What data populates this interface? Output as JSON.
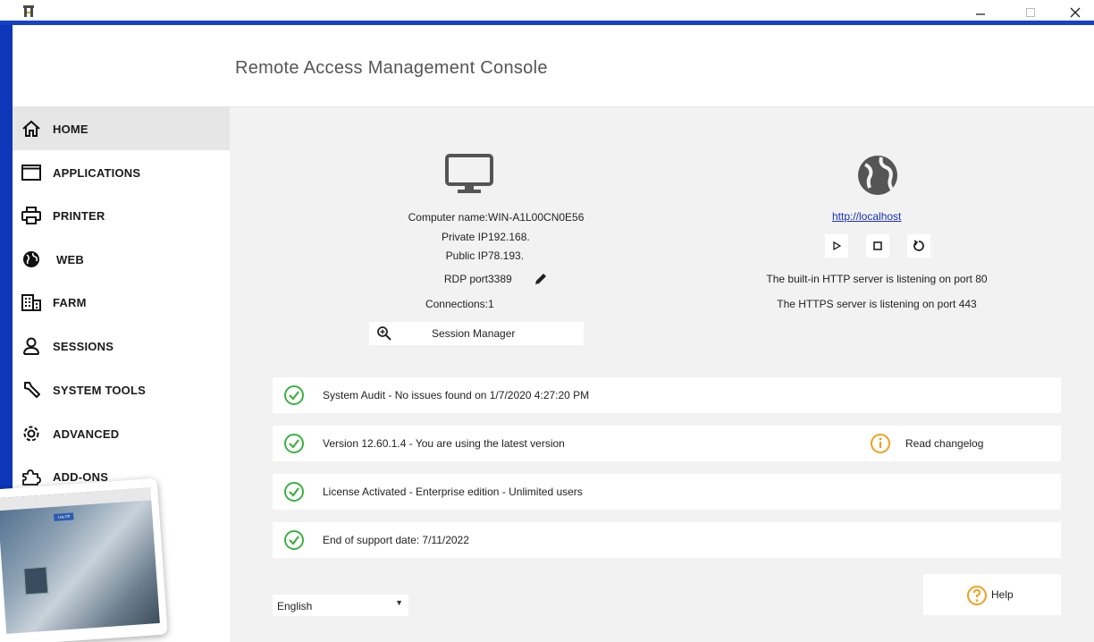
{
  "header": {
    "title": "Remote Access Management Console"
  },
  "sidebar": {
    "items": [
      {
        "label": "HOME",
        "icon": "home-icon",
        "active": true
      },
      {
        "label": "APPLICATIONS",
        "icon": "window-icon"
      },
      {
        "label": "PRINTER",
        "icon": "printer-icon"
      },
      {
        "label": "WEB",
        "icon": "globe-icon"
      },
      {
        "label": "FARM",
        "icon": "building-icon"
      },
      {
        "label": "SESSIONS",
        "icon": "user-icon"
      },
      {
        "label": "SYSTEM TOOLS",
        "icon": "wrench-icon"
      },
      {
        "label": "ADVANCED",
        "icon": "gear-icon"
      },
      {
        "label": "ADD-ONS",
        "icon": "puzzle-icon"
      }
    ]
  },
  "computer": {
    "name_label": "Computer name:",
    "name_value": "WIN-A1L00CN0E56",
    "private_label": "Private IP",
    "private_value": "192.168.",
    "public_label": "Public IP",
    "public_value": "78.193.",
    "rdp_label": "RDP port",
    "rdp_value": "3389",
    "connections_label": "Connections:",
    "connections_value": "1",
    "session_manager_label": "Session Manager"
  },
  "web": {
    "link": "http://localhost",
    "http_status": "The built-in HTTP server is listening on port 80",
    "https_status": "The HTTPS server is listening on port 443"
  },
  "status": {
    "audit": "System Audit - No issues found on 1/7/2020 4:27:20 PM",
    "version": "Version 12.60.1.4 - You are using the latest version",
    "changelog": "Read changelog",
    "license": "License Activated - Enterprise edition - Unlimited users",
    "support": "End of support date: 7/11/2022"
  },
  "footer": {
    "language": "English",
    "help": "Help"
  },
  "thumbnail": {
    "logoff": "Log Off"
  },
  "colors": {
    "accent_blue": "#1540c8",
    "check_green": "#3cb043",
    "warn_orange": "#f0a020",
    "link_blue": "#1a2fb0"
  }
}
